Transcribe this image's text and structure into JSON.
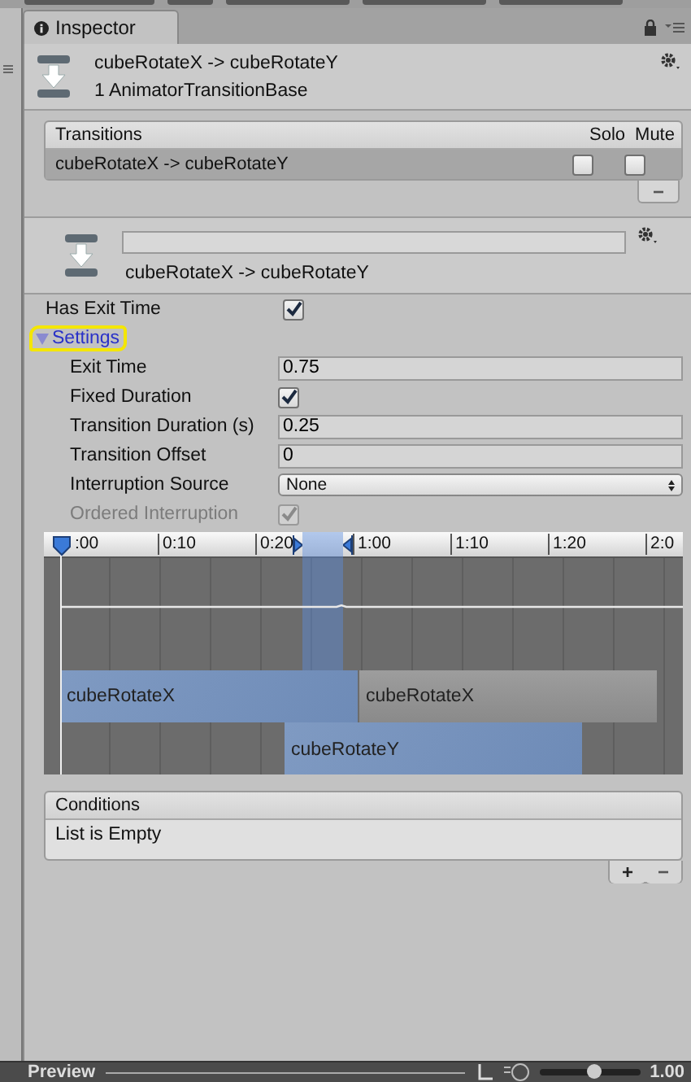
{
  "tab": {
    "label": "Inspector",
    "selected": true
  },
  "header": {
    "title": "cubeRotateX -> cubeRotateY",
    "subtitle": "1 AnimatorTransitionBase"
  },
  "transitions": {
    "columns": [
      "Transitions",
      "Solo",
      "Mute"
    ],
    "rows": [
      {
        "name": "cubeRotateX -> cubeRotateY",
        "selected": true,
        "solo": false,
        "mute": false
      }
    ],
    "remove_label": "−"
  },
  "transition_header": {
    "caption": "cubeRotateX -> cubeRotateY"
  },
  "has_exit_time": {
    "label": "Has Exit Time",
    "checked": true
  },
  "settings": {
    "label": "Settings",
    "expanded": true,
    "circled": true,
    "fields": [
      {
        "kind": "number",
        "label": "Exit Time",
        "value": "0.75"
      },
      {
        "kind": "checkbox",
        "label": "Fixed Duration",
        "checked": true,
        "disabled": false
      },
      {
        "kind": "number",
        "label": "Transition Duration (s)",
        "value": "0.25"
      },
      {
        "kind": "number",
        "label": "Transition Offset",
        "value": "0"
      },
      {
        "kind": "dropdown",
        "label": "Interruption Source",
        "value": "None"
      },
      {
        "kind": "checkbox",
        "label": "Ordered Interruption",
        "checked": true,
        "disabled": true
      }
    ]
  },
  "timeline": {
    "ticks": [
      ":00",
      "0:10",
      "0:20",
      "1:00",
      "1:10",
      "1:20",
      "2:0"
    ],
    "clips": [
      {
        "kind": "source",
        "label": "cubeRotateX"
      },
      {
        "kind": "source_after",
        "label": "cubeRotateX"
      },
      {
        "kind": "destination",
        "label": "cubeRotateY"
      }
    ]
  },
  "conditions": {
    "title": "Conditions",
    "empty_text": "List is Empty",
    "add_label": "+",
    "remove_label": "−"
  },
  "preview": {
    "title": "Preview",
    "speed": "1.00",
    "level": 0.55
  }
}
